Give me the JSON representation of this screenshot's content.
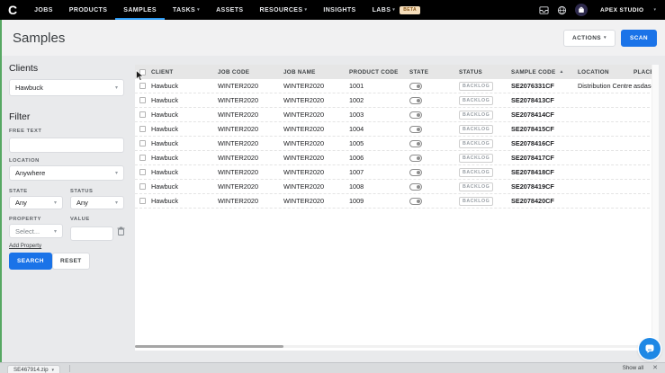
{
  "colors": {
    "topbar_bg": "#000000",
    "accent_blue": "#1a73e8",
    "active_tab_underline": "#2b9af3",
    "labs_badge_bg": "#f6debb",
    "left_strip_green": "#57a863",
    "chat_bubble_blue": "#1e88e5"
  },
  "topnav": {
    "logo": "C",
    "items": [
      {
        "id": "jobs",
        "label": "JOBS",
        "active": false,
        "caret": false
      },
      {
        "id": "products",
        "label": "PRODUCTS",
        "active": false,
        "caret": false
      },
      {
        "id": "samples",
        "label": "SAMPLES",
        "active": true,
        "caret": false
      },
      {
        "id": "tasks",
        "label": "TASKS",
        "active": false,
        "caret": true
      },
      {
        "id": "assets",
        "label": "ASSETS",
        "active": false,
        "caret": false
      },
      {
        "id": "resources",
        "label": "RESOURCES",
        "active": false,
        "caret": true
      },
      {
        "id": "insights",
        "label": "INSIGHTS",
        "active": false,
        "caret": false
      },
      {
        "id": "labs",
        "label": "LABS",
        "active": false,
        "caret": true,
        "badge": "BETA"
      }
    ],
    "account_name": "APEX STUDIO"
  },
  "header": {
    "title": "Samples",
    "actions_button": "ACTIONS",
    "scan_button": "SCAN"
  },
  "sidebar": {
    "clients_heading": "Clients",
    "client_selected": "Hawbuck",
    "filter_heading": "Filter",
    "free_text_label": "FREE TEXT",
    "free_text_value": "",
    "location_label": "LOCATION",
    "location_selected": "Anywhere",
    "state_label": "STATE",
    "state_selected": "Any",
    "status_label": "STATUS",
    "status_selected": "Any",
    "property_label": "PROPERTY",
    "property_placeholder": "Select...",
    "value_label": "VALUE",
    "value_value": "",
    "add_property_label": "Add Property",
    "search_button": "SEARCH",
    "reset_button": "RESET"
  },
  "table": {
    "columns": [
      "CLIENT",
      "JOB CODE",
      "JOB NAME",
      "PRODUCT CODE",
      "STATE",
      "STATUS",
      "SAMPLE CODE",
      "LOCATION",
      "PLACE"
    ],
    "sorted_column": "SAMPLE CODE",
    "sort_direction": "asc",
    "rows": [
      {
        "client": "Hawbuck",
        "job_code": "WINTER2020",
        "job_name": "WINTER2020",
        "product_code": "1001",
        "state_toggle": "off",
        "status": "BACKLOG",
        "sample_code": "SE2076331CF",
        "location": "Distribution Centre",
        "place": "asdasd"
      },
      {
        "client": "Hawbuck",
        "job_code": "WINTER2020",
        "job_name": "WINTER2020",
        "product_code": "1002",
        "state_toggle": "off",
        "status": "BACKLOG",
        "sample_code": "SE2078413CF",
        "location": "",
        "place": ""
      },
      {
        "client": "Hawbuck",
        "job_code": "WINTER2020",
        "job_name": "WINTER2020",
        "product_code": "1003",
        "state_toggle": "off",
        "status": "BACKLOG",
        "sample_code": "SE2078414CF",
        "location": "",
        "place": ""
      },
      {
        "client": "Hawbuck",
        "job_code": "WINTER2020",
        "job_name": "WINTER2020",
        "product_code": "1004",
        "state_toggle": "off",
        "status": "BACKLOG",
        "sample_code": "SE2078415CF",
        "location": "",
        "place": ""
      },
      {
        "client": "Hawbuck",
        "job_code": "WINTER2020",
        "job_name": "WINTER2020",
        "product_code": "1005",
        "state_toggle": "off",
        "status": "BACKLOG",
        "sample_code": "SE2078416CF",
        "location": "",
        "place": ""
      },
      {
        "client": "Hawbuck",
        "job_code": "WINTER2020",
        "job_name": "WINTER2020",
        "product_code": "1006",
        "state_toggle": "off",
        "status": "BACKLOG",
        "sample_code": "SE2078417CF",
        "location": "",
        "place": ""
      },
      {
        "client": "Hawbuck",
        "job_code": "WINTER2020",
        "job_name": "WINTER2020",
        "product_code": "1007",
        "state_toggle": "off",
        "status": "BACKLOG",
        "sample_code": "SE2078418CF",
        "location": "",
        "place": ""
      },
      {
        "client": "Hawbuck",
        "job_code": "WINTER2020",
        "job_name": "WINTER2020",
        "product_code": "1008",
        "state_toggle": "off",
        "status": "BACKLOG",
        "sample_code": "SE2078419CF",
        "location": "",
        "place": ""
      },
      {
        "client": "Hawbuck",
        "job_code": "WINTER2020",
        "job_name": "WINTER2020",
        "product_code": "1009",
        "state_toggle": "off",
        "status": "BACKLOG",
        "sample_code": "SE2078420CF",
        "location": "",
        "place": ""
      }
    ]
  },
  "statusbar": {
    "download_file": "SE467914.zip",
    "show_all": "Show all"
  }
}
